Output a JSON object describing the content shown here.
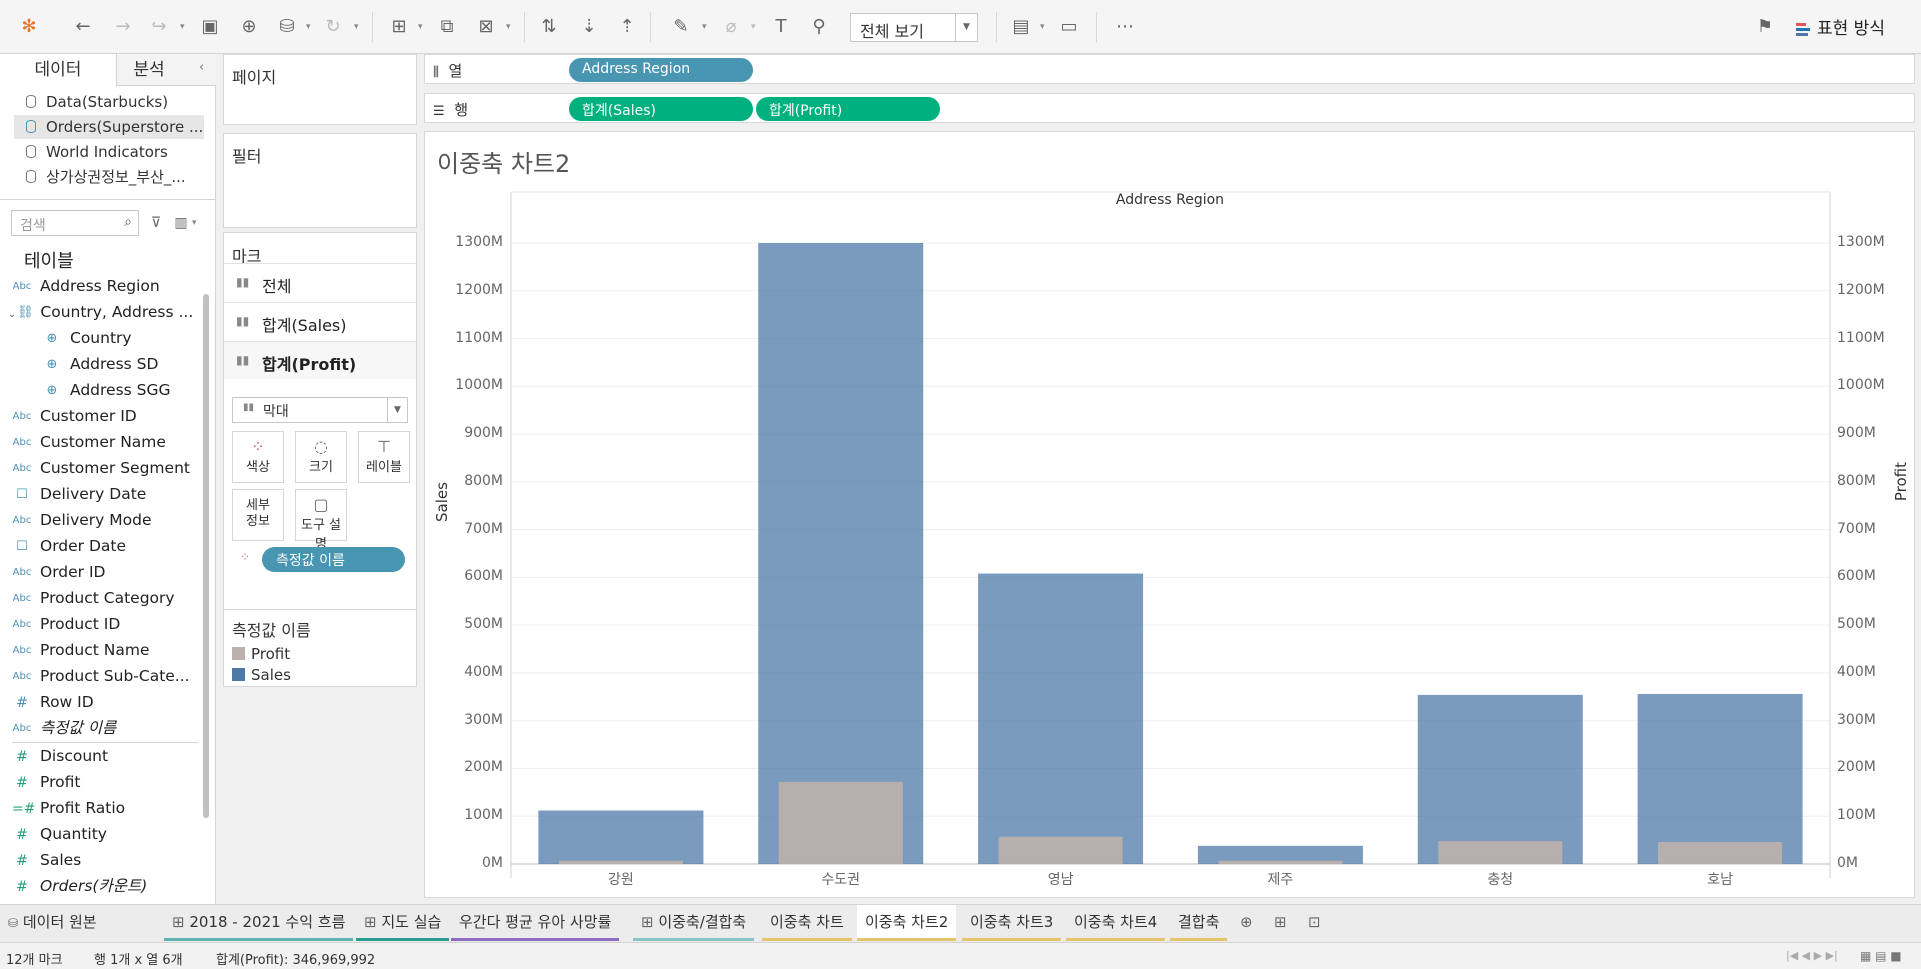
{
  "toolbar": {
    "view_select": "전체 보기",
    "show_me": "표현 방식"
  },
  "datapane": {
    "tab_data": "데이터",
    "tab_analytics": "분석",
    "datasources": [
      "Data(Starbucks)",
      "Orders(Superstore ...",
      "World Indicators",
      "상가상권정보_부산_..."
    ],
    "search_placeholder": "검색",
    "tables_header": "테이블",
    "fields": [
      {
        "type": "Abc",
        "name": "Address Region"
      },
      {
        "type": "hier",
        "name": "Country, Address ..."
      },
      {
        "type": "geo",
        "name": "Country"
      },
      {
        "type": "geo",
        "name": "Address SD"
      },
      {
        "type": "geo",
        "name": "Address SGG"
      },
      {
        "type": "Abc",
        "name": "Customer ID"
      },
      {
        "type": "Abc",
        "name": "Customer Name"
      },
      {
        "type": "Abc",
        "name": "Customer Segment"
      },
      {
        "type": "date",
        "name": "Delivery Date"
      },
      {
        "type": "Abc",
        "name": "Delivery Mode"
      },
      {
        "type": "date",
        "name": "Order Date"
      },
      {
        "type": "Abc",
        "name": "Order ID"
      },
      {
        "type": "Abc",
        "name": "Product Category"
      },
      {
        "type": "Abc",
        "name": "Product ID"
      },
      {
        "type": "Abc",
        "name": "Product Name"
      },
      {
        "type": "Abc",
        "name": "Product Sub-Cate..."
      },
      {
        "type": "#",
        "name": "Row ID"
      },
      {
        "type": "Abc",
        "name": "측정값 이름"
      },
      {
        "type": "#",
        "name": "Discount"
      },
      {
        "type": "#",
        "name": "Profit"
      },
      {
        "type": "calc",
        "name": "Profit Ratio"
      },
      {
        "type": "#",
        "name": "Quantity"
      },
      {
        "type": "#",
        "name": "Sales"
      },
      {
        "type": "#",
        "name": "Orders(카운트)"
      }
    ]
  },
  "cards": {
    "pages": "페이지",
    "filters": "필터",
    "marks": "마크",
    "marks_all": "전체",
    "marks_sales": "합계(Sales)",
    "marks_profit": "합계(Profit)",
    "mark_type": "막대",
    "btn_color": "색상",
    "btn_size": "크기",
    "btn_label": "레이블",
    "btn_detail": "세부\n정보",
    "btn_tooltip": "도구 설명",
    "measure_pill": "측정값 이름",
    "legend_title": "측정값 이름",
    "legend": [
      {
        "name": "Profit",
        "color": "#bab0ac"
      },
      {
        "name": "Sales",
        "color": "#4e79a7"
      }
    ]
  },
  "shelves": {
    "columns_label": "열",
    "rows_label": "행",
    "columns_pill": "Address Region",
    "rows_pills": [
      "합계(Sales)",
      "합계(Profit)"
    ]
  },
  "view": {
    "title": "이중축 차트2",
    "header": "Address Region"
  },
  "chart_data": {
    "type": "bar",
    "title": "이중축 차트2",
    "xlabel": "Address Region",
    "ylabel": "Sales",
    "y2label": "Profit",
    "categories": [
      "강원",
      "수도권",
      "영남",
      "제주",
      "충청",
      "호남"
    ],
    "ylim": [
      0,
      1300000000
    ],
    "yticks": [
      "0M",
      "100M",
      "200M",
      "300M",
      "400M",
      "500M",
      "600M",
      "700M",
      "800M",
      "900M",
      "1000M",
      "1100M",
      "1200M",
      "1300M"
    ],
    "series": [
      {
        "name": "Sales",
        "color": "#4e79a7",
        "values": [
          112000000,
          1300000000,
          608000000,
          38000000,
          354000000,
          356000000
        ]
      },
      {
        "name": "Profit",
        "color": "#bab0ac",
        "values": [
          7000000,
          172000000,
          57000000,
          7000000,
          48000000,
          46000000
        ]
      }
    ]
  },
  "tabs": {
    "datasource": "데이터 원본",
    "sheets": [
      "2018 - 2021 수익 흐름",
      "지도 실습",
      "우간다 평균 유아 사망률",
      "이중축/결합축",
      "이중축 차트",
      "이중축 차트2",
      "이중축 차트3",
      "이중축 차트4",
      "결합축"
    ],
    "active": "이중축 차트2"
  },
  "status": {
    "marks": "12개 마크",
    "dims": "행 1개 x 열 6개",
    "sum": "합계(Profit): 346,969,992"
  }
}
